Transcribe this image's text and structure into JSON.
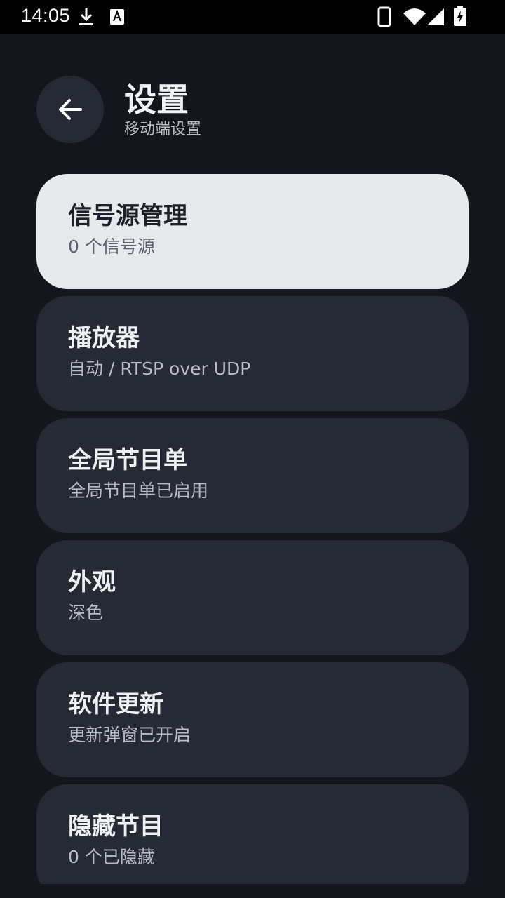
{
  "status_bar": {
    "time": "14:05",
    "icons": [
      "download-icon",
      "text-a-icon",
      "phone-icon",
      "wifi-icon",
      "signal-icon",
      "battery-charging-icon"
    ]
  },
  "header": {
    "back_icon": "arrow-left-icon",
    "title": "设置",
    "subtitle": "移动端设置"
  },
  "settings": [
    {
      "title": "信号源管理",
      "subtitle": "0 个信号源",
      "selected": true
    },
    {
      "title": "播放器",
      "subtitle": "自动 / RTSP over UDP",
      "selected": false
    },
    {
      "title": "全局节目单",
      "subtitle": "全局节目单已启用",
      "selected": false
    },
    {
      "title": "外观",
      "subtitle": "深色",
      "selected": false
    },
    {
      "title": "软件更新",
      "subtitle": "更新弹窗已开启",
      "selected": false
    },
    {
      "title": "隐藏节目",
      "subtitle": "0 个已隐藏",
      "selected": false
    }
  ],
  "colors": {
    "background": "#13161d",
    "card": "#262a34",
    "card_selected": "#e8e9ed",
    "status_bar": "#000000"
  }
}
